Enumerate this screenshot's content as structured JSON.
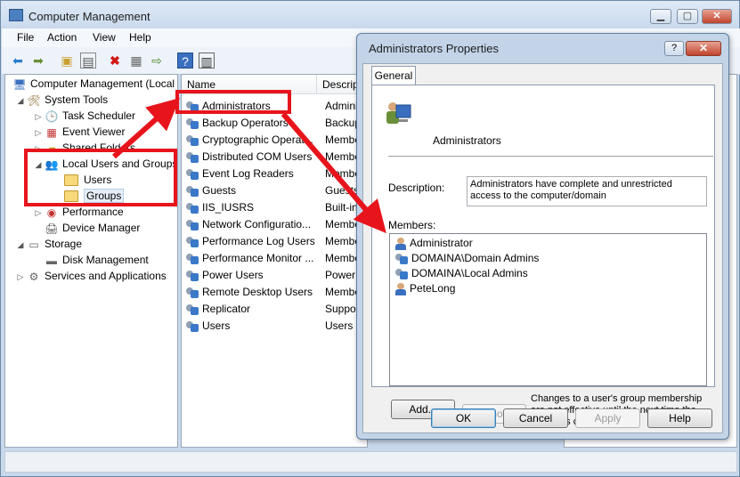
{
  "window": {
    "title": "Computer Management",
    "controls": {
      "minimize": "▁",
      "maximize": "▢",
      "close": "✕"
    }
  },
  "menu": [
    "File",
    "Action",
    "View",
    "Help"
  ],
  "toolbar_icons": [
    "back-arrow-icon",
    "forward-arrow-icon",
    "up-folder-icon",
    "show-tree-icon",
    "delete-icon",
    "properties-icon",
    "export-icon",
    "help-icon",
    "action-pane-icon"
  ],
  "tree": {
    "root": "Computer Management (Local",
    "system_tools": "System Tools",
    "task_scheduler": "Task Scheduler",
    "event_viewer": "Event Viewer",
    "shared_folders": "Shared Folders",
    "local_users_groups": "Local Users and Groups",
    "users": "Users",
    "groups": "Groups",
    "performance": "Performance",
    "device_manager": "Device Manager",
    "storage": "Storage",
    "disk_management": "Disk Management",
    "services_apps": "Services and Applications"
  },
  "list": {
    "columns": {
      "name": "Name",
      "description": "Descript"
    },
    "rows": [
      {
        "name": "Administrators",
        "desc": "Adminis"
      },
      {
        "name": "Backup Operators",
        "desc": "Backup"
      },
      {
        "name": "Cryptographic Operat...",
        "desc": "Membe"
      },
      {
        "name": "Distributed COM Users",
        "desc": "Membe"
      },
      {
        "name": "Event Log Readers",
        "desc": "Membe"
      },
      {
        "name": "Guests",
        "desc": "Guests h"
      },
      {
        "name": "IIS_IUSRS",
        "desc": "Built-in"
      },
      {
        "name": "Network Configuratio...",
        "desc": "Membe"
      },
      {
        "name": "Performance Log Users",
        "desc": "Membe"
      },
      {
        "name": "Performance Monitor ...",
        "desc": "Membe"
      },
      {
        "name": "Power Users",
        "desc": "Power U"
      },
      {
        "name": "Remote Desktop Users",
        "desc": "Membe"
      },
      {
        "name": "Replicator",
        "desc": "Support"
      },
      {
        "name": "Users",
        "desc": "Users ar"
      }
    ]
  },
  "dialog": {
    "title": "Administrators Properties",
    "help_btn": "?",
    "close_btn": "✕",
    "tab": "General",
    "group_name": "Administrators",
    "description_label": "Description:",
    "description_value": "Administrators have complete and unrestricted access to the computer/domain",
    "members_label": "Members:",
    "members": [
      {
        "name": "Administrator",
        "icon": "user-icon"
      },
      {
        "name": "DOMAINA\\Domain Admins",
        "icon": "group-icon"
      },
      {
        "name": "DOMAINA\\Local Admins",
        "icon": "group-icon"
      },
      {
        "name": "PeteLong",
        "icon": "user-icon"
      }
    ],
    "add_btn": "Add...",
    "remove_btn": "Remove",
    "note": "Changes to a user's group membership are not effective until the next time the user logs on.",
    "ok_btn": "OK",
    "cancel_btn": "Cancel",
    "apply_btn": "Apply",
    "help_button": "Help"
  },
  "annotation_color": "#e8141c"
}
